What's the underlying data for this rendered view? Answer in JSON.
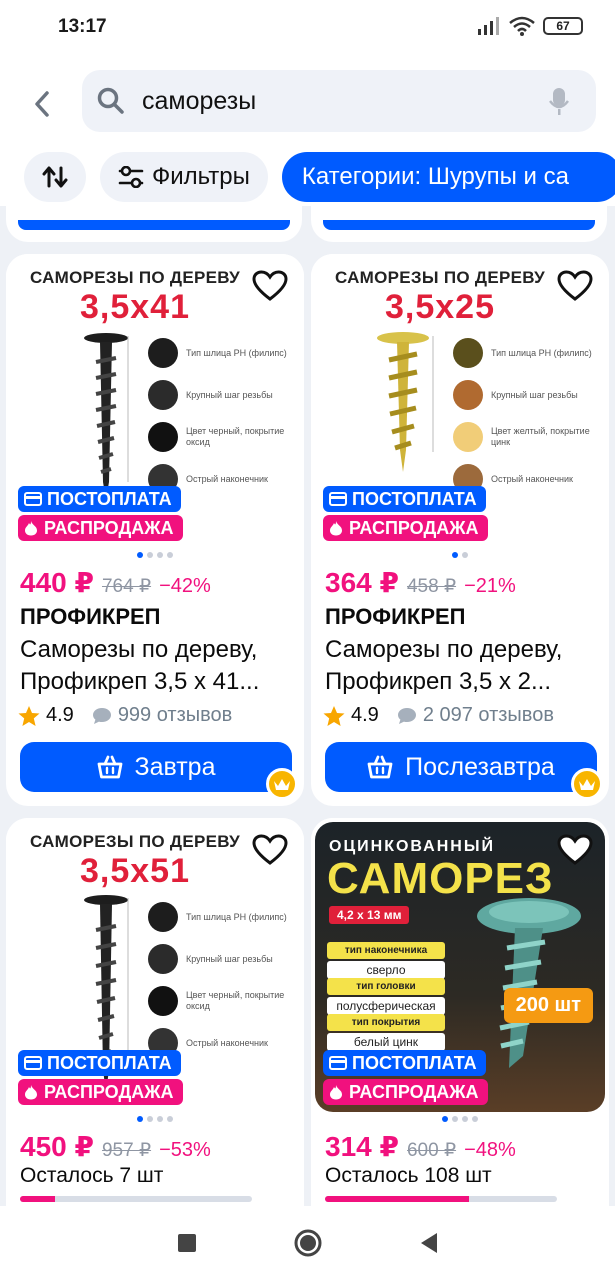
{
  "status": {
    "time": "13:17",
    "battery": "67"
  },
  "search": {
    "query": "саморезы"
  },
  "chips": {
    "filters": "Фильтры",
    "category": "Категории: Шурупы и са"
  },
  "products": [
    {
      "img_title": "САМОРЕЗЫ ПО ДЕРЕВУ",
      "img_size": "3,5x41",
      "features": [
        "Тип шлица PH (филипс)",
        "Крупный шаг резьбы",
        "Цвет черный, покрытие оксид",
        "Острый наконечник"
      ],
      "badge_pay": "ПОСТОПЛАТА",
      "badge_sale": "РАСПРОДАЖА",
      "price": "440 ₽",
      "old_price": "764 ₽",
      "discount": "−42%",
      "brand": "ПРОФИКРЕП",
      "name": "Саморезы по дереву, Профикреп 3,5 х 41...",
      "rating": "4.9",
      "reviews": "999 отзывов",
      "delivery": "Завтра"
    },
    {
      "img_title": "САМОРЕЗЫ ПО ДЕРЕВУ",
      "img_size": "3,5x25",
      "features": [
        "Тип шлица PH (филипс)",
        "Крупный шаг резьбы",
        "Цвет желтый, покрытие цинк",
        "Острый наконечник"
      ],
      "badge_pay": "ПОСТОПЛАТА",
      "badge_sale": "РАСПРОДАЖА",
      "price": "364 ₽",
      "old_price": "458 ₽",
      "discount": "−21%",
      "brand": "ПРОФИКРЕП",
      "name": "Саморезы по дереву, Профикреп 3,5 х 2...",
      "rating": "4.9",
      "reviews": "2 097 отзывов",
      "delivery": "Послезавтра"
    },
    {
      "img_title": "САМОРЕЗЫ ПО ДЕРЕВУ",
      "img_size": "3,5x51",
      "features": [
        "Тип шлица PH (филипс)",
        "Крупный шаг резьбы",
        "Цвет черный, покрытие оксид",
        "Острый наконечник"
      ],
      "badge_pay": "ПОСТОПЛАТА",
      "badge_sale": "РАСПРОДАЖА",
      "price": "450 ₽",
      "old_price": "957 ₽",
      "discount": "−53%",
      "stock": "Осталось 7 шт",
      "stock_fraction": 0.15
    },
    {
      "img_title": "ОЦИНКОВАННЫЙ",
      "img_big": "САМОРЕЗ",
      "img_size": "4,2 х 13 мм",
      "specs": [
        {
          "k": "тип наконечника",
          "v": "сверло"
        },
        {
          "k": "тип головки",
          "v": "полусферическая"
        },
        {
          "k": "тип покрытия",
          "v": "белый цинк"
        }
      ],
      "pack": "200 шт",
      "badge_pay": "ПОСТОПЛАТА",
      "badge_sale": "РАСПРОДАЖА",
      "price": "314 ₽",
      "old_price": "600 ₽",
      "discount": "−48%",
      "stock": "Осталось 108 шт",
      "stock_fraction": 0.62
    }
  ]
}
